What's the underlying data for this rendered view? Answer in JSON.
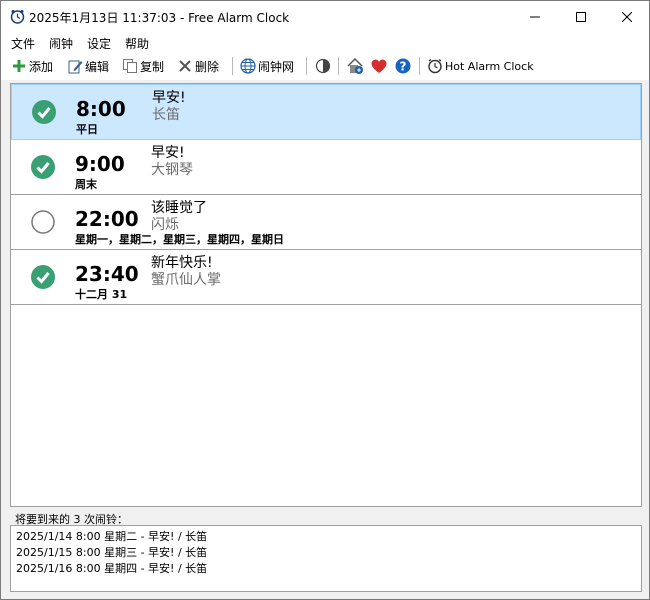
{
  "window": {
    "title": "2025年1月13日 11:37:03 - Free Alarm Clock"
  },
  "menu": [
    "文件",
    "闹钟",
    "设定",
    "帮助"
  ],
  "toolbar": {
    "add": "添加",
    "edit": "编辑",
    "copy": "复制",
    "delete": "删除",
    "web": "闹钟网",
    "hot": "Hot Alarm Clock"
  },
  "alarms": [
    {
      "time": "8:00",
      "days": "平日",
      "label": "早安!",
      "sound": "长笛",
      "enabled": true,
      "selected": true
    },
    {
      "time": "9:00",
      "days": "周末",
      "label": "早安!",
      "sound": "大钢琴",
      "enabled": true,
      "selected": false
    },
    {
      "time": "22:00",
      "days": "星期一，星期二，星期三，星期四，星期日",
      "label": "该睡觉了",
      "sound": "闪烁",
      "enabled": false,
      "selected": false
    },
    {
      "time": "23:40",
      "days": "十二月 31",
      "label": "新年快乐!",
      "sound": "蟹爪仙人掌",
      "enabled": true,
      "selected": false
    }
  ],
  "upcoming": {
    "title": "将要到来的 3 次闹铃：",
    "items": [
      "2025/1/14 8:00 星期二 - 早安! / 长笛",
      "2025/1/15 8:00 星期三 - 早安! / 长笛",
      "2025/1/16 8:00 星期四 - 早安! / 长笛"
    ]
  },
  "colors": {
    "check_green": "#3aa074",
    "selected_bg": "#cce8ff",
    "heart_red": "#d32f2f",
    "help_blue": "#1565c0"
  }
}
